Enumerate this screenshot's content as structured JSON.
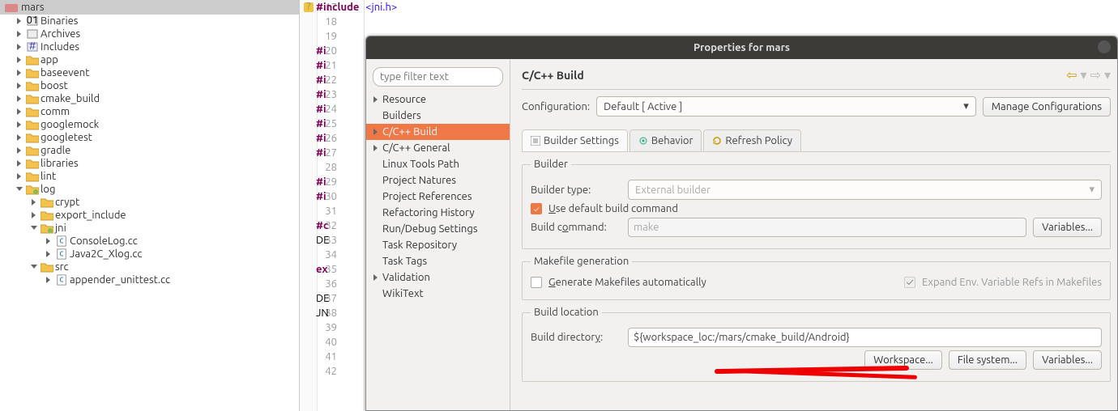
{
  "explorer": {
    "root": "mars",
    "top": [
      "Binaries",
      "Archives",
      "Includes"
    ],
    "folders": [
      "app",
      "baseevent",
      "boost",
      "cmake_build",
      "comm",
      "googlemock",
      "googletest",
      "gradle",
      "libraries",
      "lint"
    ],
    "log_folder": "log",
    "log_children_folders": [
      "crypt",
      "export_include"
    ],
    "jni_folder": "jni",
    "jni_files": [
      "ConsoleLog.cc",
      "Java2C_Xlog.cc"
    ],
    "src_folder": "src",
    "src_files": [
      "appender_unittest.cc"
    ]
  },
  "editor": {
    "lines": [
      "17",
      "18",
      "19",
      "20",
      "21",
      "22",
      "23",
      "24",
      "25",
      "26",
      "27",
      "28",
      "29",
      "30",
      "31",
      "32",
      "33",
      "34",
      "35",
      "36",
      "37",
      "38",
      "39",
      "40",
      "41",
      "42"
    ],
    "line17_kw": "#include",
    "line17_inc": "<jni.h>",
    "stub_i": "#i",
    "stub_c": "#c",
    "stub_DE": "DE",
    "stub_ex": "ex",
    "stub_JN": "JN"
  },
  "dialog": {
    "title": "Properties for mars",
    "filter_placeholder": "type filter text",
    "nav": [
      "Resource",
      "Builders",
      "C/C++ Build",
      "C/C++ General",
      "Linux Tools Path",
      "Project Natures",
      "Project References",
      "Refactoring History",
      "Run/Debug Settings",
      "Task Repository",
      "Task Tags",
      "Validation",
      "WikiText"
    ],
    "selected_nav": "C/C++ Build",
    "heading": "C/C++ Build",
    "config_label": "Configuration:",
    "config_value": "Default  [ Active ]",
    "manage_btn": "Manage Configurations",
    "tabs": {
      "builder": "Builder Settings",
      "behavior": "Behavior",
      "refresh": "Refresh Policy"
    },
    "builder": {
      "legend": "Builder",
      "type_label": "Builder type:",
      "type_value": "External builder",
      "use_default_label": "Use default build command",
      "command_label": "Build command:",
      "command_value": "make",
      "variables_btn": "Variables..."
    },
    "makefile": {
      "legend": "Makefile generation",
      "gen_label": "Generate Makefiles automatically",
      "expand_label": "Expand Env. Variable Refs in Makefiles"
    },
    "location": {
      "legend": "Build location",
      "dir_label": "Build directory:",
      "dir_value": "${workspace_loc:/mars/cmake_build/Android}",
      "workspace_btn": "Workspace...",
      "filesystem_btn": "File system...",
      "variables_btn": "Variables..."
    }
  }
}
